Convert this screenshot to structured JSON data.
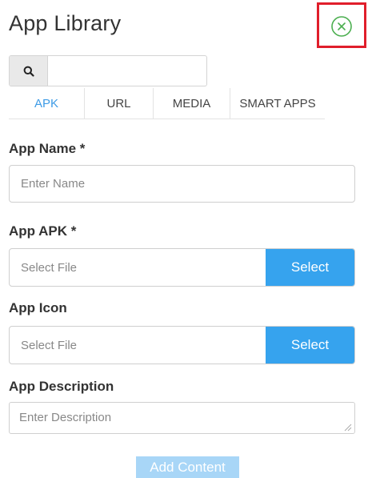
{
  "header": {
    "title": "App Library",
    "close_icon": "circle-x-icon",
    "close_color": "#4caf50",
    "highlight_color": "#e01e2b"
  },
  "search": {
    "icon": "search-icon",
    "placeholder": ""
  },
  "tabs": [
    {
      "label": "APK",
      "active": true
    },
    {
      "label": "URL",
      "active": false
    },
    {
      "label": "MEDIA",
      "active": false
    },
    {
      "label": "SMART APPS",
      "active": false
    }
  ],
  "form": {
    "app_name": {
      "label": "App Name *",
      "placeholder": "Enter Name"
    },
    "app_apk": {
      "label": "App APK *",
      "placeholder": "Select File",
      "button": "Select"
    },
    "app_icon": {
      "label": "App Icon",
      "placeholder": "Select File",
      "button": "Select"
    },
    "app_description": {
      "label": "App Description",
      "placeholder": "Enter Description"
    },
    "submit": "Add Content"
  },
  "colors": {
    "accent": "#36a3ee",
    "tab_active": "#3d9be6",
    "submit_disabled": "#a8d6f7"
  }
}
